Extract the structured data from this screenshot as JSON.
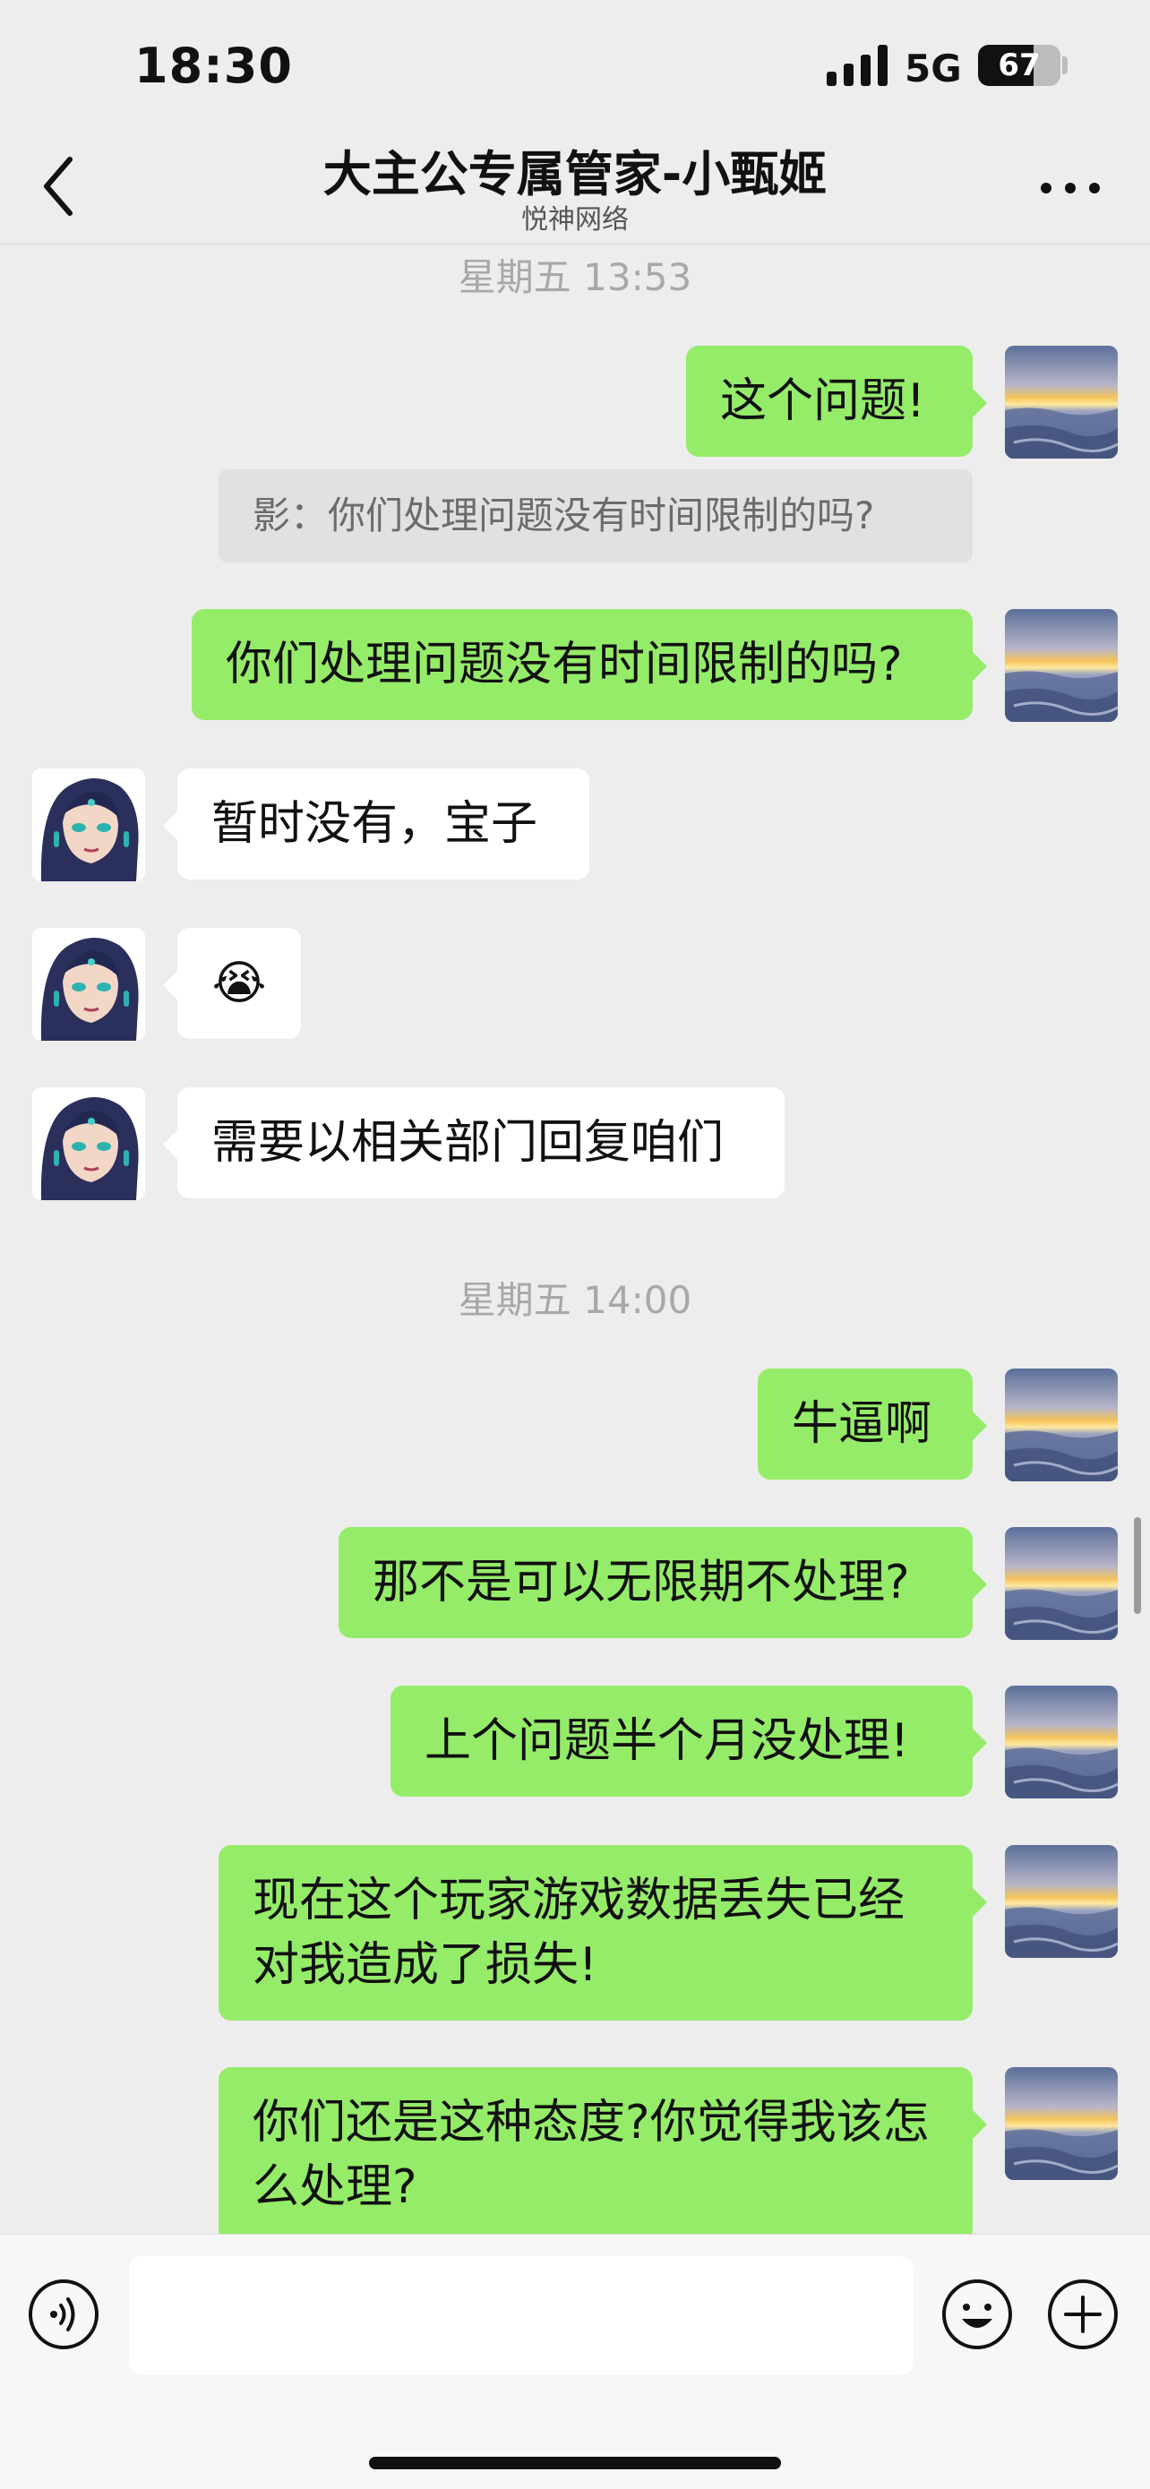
{
  "status_bar": {
    "time": "18:30",
    "network": "5G",
    "battery": "67",
    "battery_level": 0.67
  },
  "header": {
    "title": "大主公专属管家-小甄姬",
    "subtitle": "悦神网络"
  },
  "chat": {
    "timestamps": [
      "星期五 13:53",
      "星期五 14:00"
    ],
    "quote": "影：你们处理问题没有时间限制的吗?",
    "messages": [
      {
        "from": "me",
        "text": "这个问题!"
      },
      {
        "from": "me",
        "text": "你们处理问题没有时间限制的吗?"
      },
      {
        "from": "them",
        "text": "暂时没有，宝子"
      },
      {
        "from": "them",
        "text": "😭"
      },
      {
        "from": "them",
        "text": "需要以相关部门回复咱们"
      },
      {
        "from": "me",
        "text": "牛逼啊"
      },
      {
        "from": "me",
        "text": "那不是可以无限期不处理?"
      },
      {
        "from": "me",
        "text": "上个问题半个月没处理!"
      },
      {
        "from": "me",
        "text": "现在这个玩家游戏数据丢失已经对我造成了损失!"
      },
      {
        "from": "me",
        "text": "你们还是这种态度?你觉得我该怎么处理?"
      }
    ]
  },
  "input": {
    "value": ""
  },
  "icons": {
    "back": "chevron-left-icon",
    "more": "more-icon",
    "voice": "voice-icon",
    "emoji": "emoji-icon",
    "plus": "plus-icon"
  },
  "colors": {
    "my_bubble": "#95ec69",
    "their_bubble": "#ffffff",
    "background": "#ededed"
  }
}
